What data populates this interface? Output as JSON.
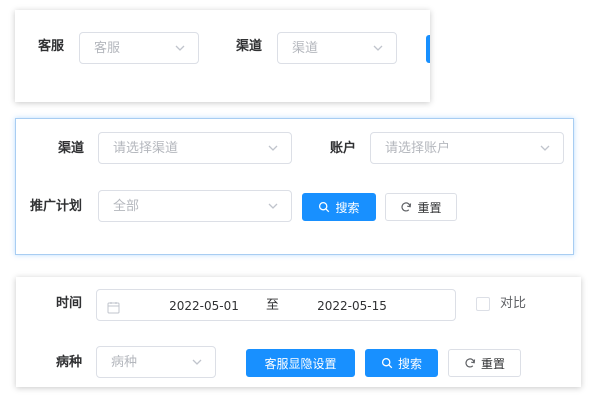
{
  "panel1": {
    "service_label": "客服",
    "service_placeholder": "客服",
    "channel_label": "渠道",
    "channel_placeholder": "渠道"
  },
  "panel2": {
    "channel_label": "渠道",
    "channel_placeholder": "请选择渠道",
    "account_label": "账户",
    "account_placeholder": "请选择账户",
    "plan_label": "推广计划",
    "plan_value": "全部",
    "search_label": "搜索",
    "reset_label": "重置"
  },
  "panel3": {
    "time_label": "时间",
    "date_start": "2022-05-01",
    "date_separator": "至",
    "date_end": "2022-05-15",
    "compare_label": "对比",
    "compare_checked": false,
    "disease_label": "病种",
    "disease_placeholder": "病种",
    "settings_label": "客服显隐设置",
    "search_label": "搜索",
    "reset_label": "重置"
  },
  "colors": {
    "primary": "#1890ff",
    "border": "#dcdfe6",
    "placeholder": "#b4b7bd",
    "label": "#303133"
  },
  "icons": [
    "chevron-down-icon",
    "search-icon",
    "refresh-icon",
    "calendar-icon"
  ]
}
